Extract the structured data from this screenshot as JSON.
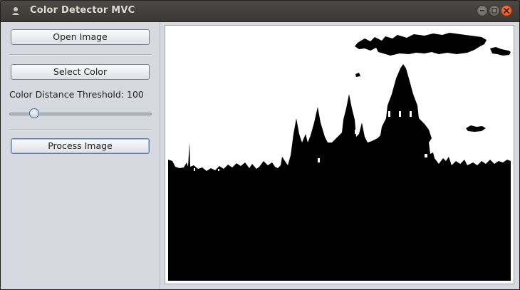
{
  "window": {
    "title": "Color Detector MVC"
  },
  "controls": {
    "open_image_label": "Open Image",
    "select_color_label": "Select Color",
    "threshold_label": "Color Distance Threshold: 100",
    "threshold_value": 100,
    "threshold_fraction": 0.15,
    "process_image_label": "Process Image"
  },
  "image": {
    "description_icon": "castle-silhouette-image"
  },
  "colors": {
    "close_button": "#df4a16",
    "titlebar": "#3c3b37"
  }
}
